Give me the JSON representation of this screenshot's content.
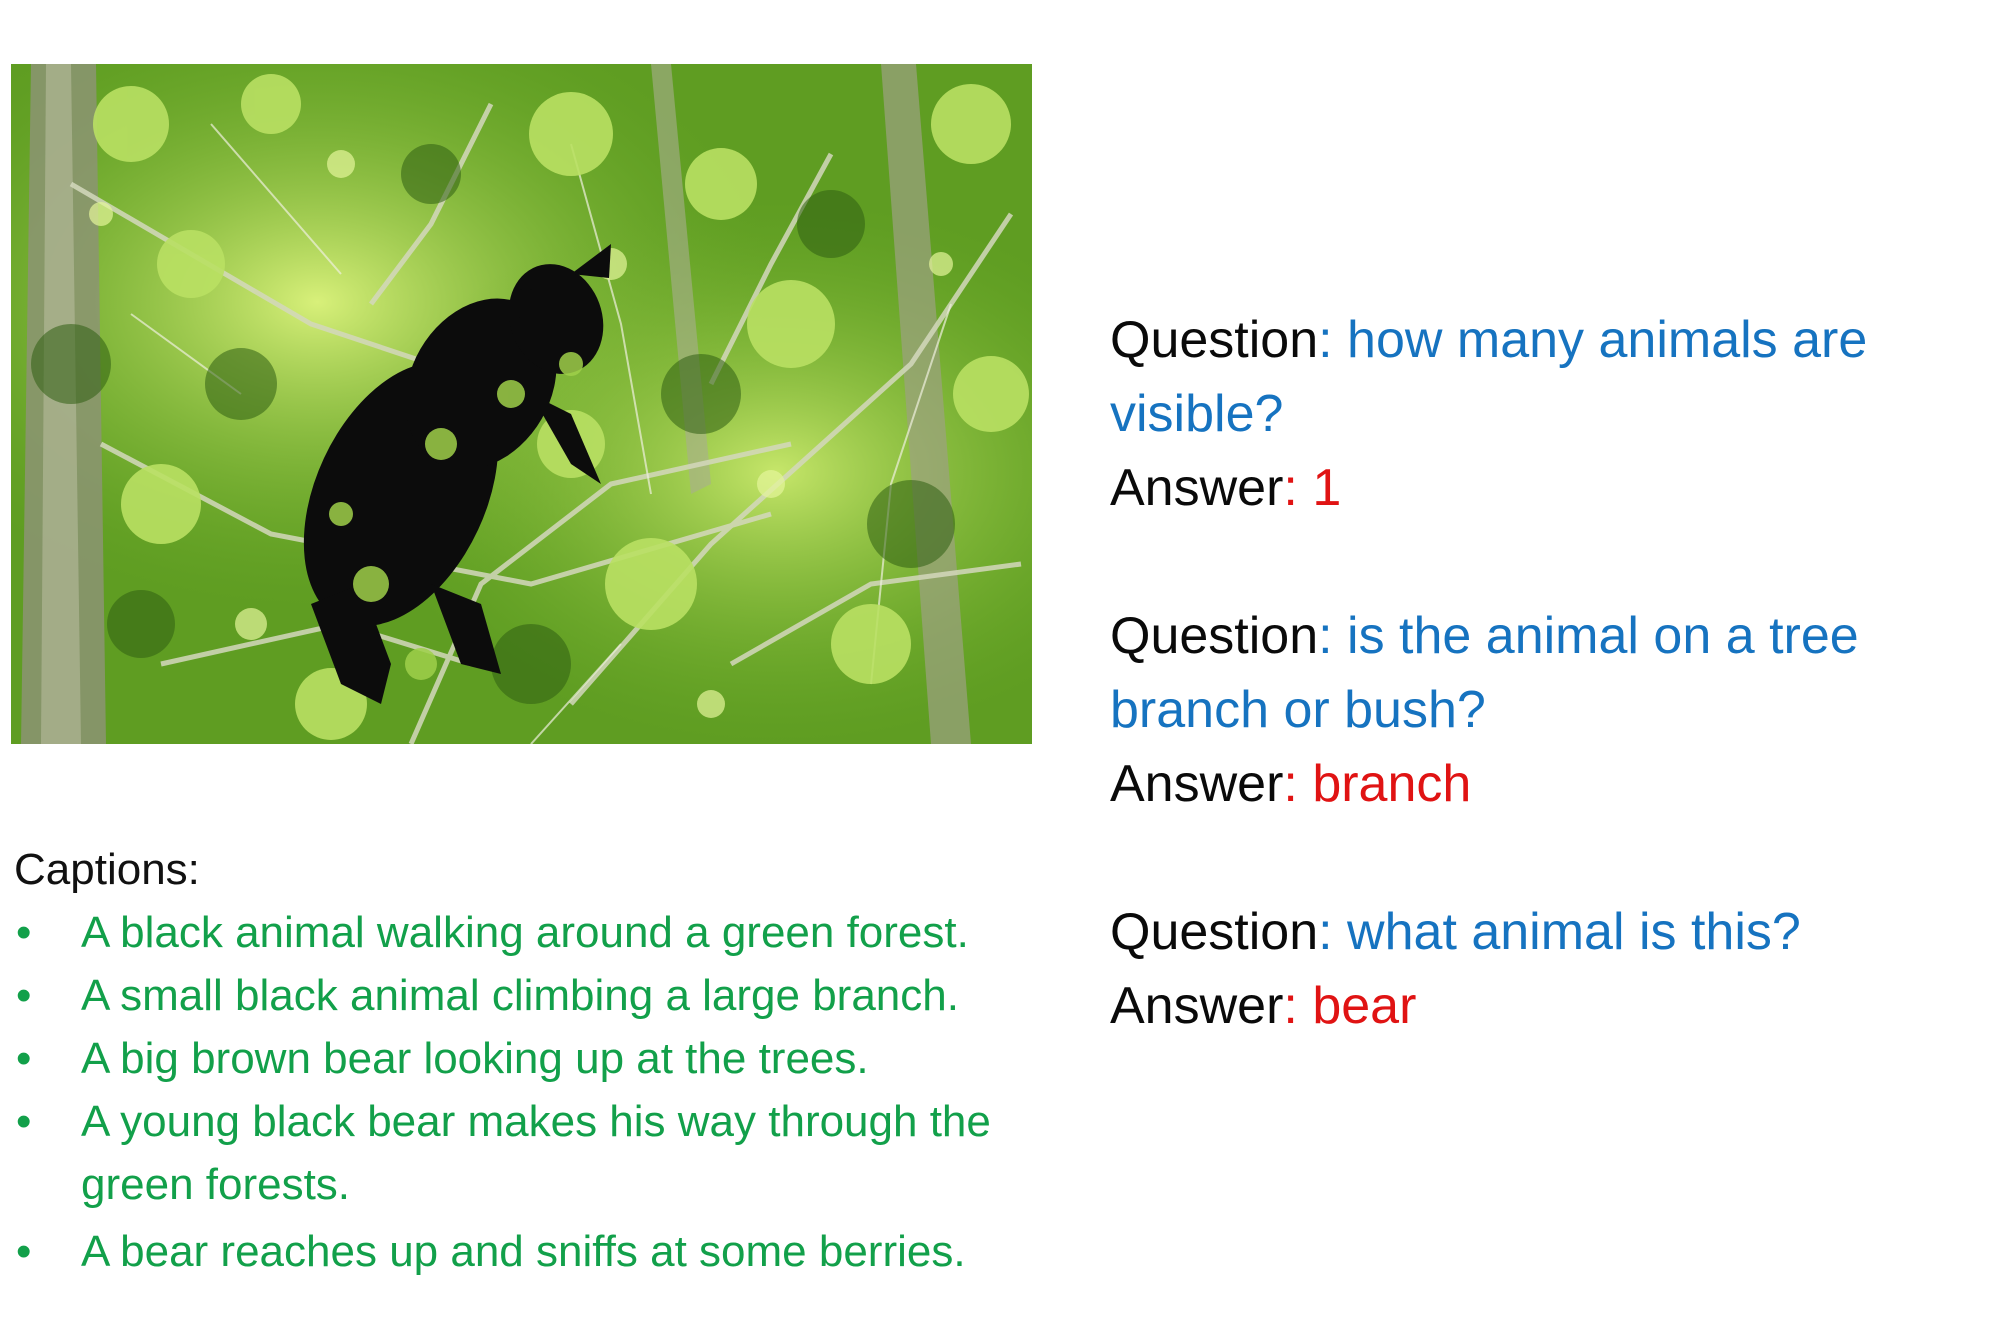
{
  "photo": {
    "subject": "bear-in-tree-photo",
    "colors": {
      "foliage": "#6fae2a",
      "light_leaves": "#b9e063",
      "dark_leaves": "#2f5e12",
      "bear": "#0c0c0c",
      "branches": "#cfd3b8"
    }
  },
  "captions": {
    "heading": "Captions:",
    "bullet": "•",
    "items": [
      "A black animal walking around a green forest.",
      "A small black animal climbing a large branch.",
      "A big brown bear looking up at the trees.",
      "A young black bear makes his way through the green forests.",
      "A bear reaches up and sniffs at some berries."
    ]
  },
  "qa": {
    "question_label": "Question",
    "answer_label": "Answer",
    "separator": ": ",
    "pairs": [
      {
        "question": "how many animals are visible?",
        "answer": "1"
      },
      {
        "question": "is the animal on a tree branch or bush?",
        "answer": "branch"
      },
      {
        "question": "what animal is this?",
        "answer": "bear"
      }
    ]
  },
  "colors": {
    "label": "#0a0a0a",
    "question": "#1673c0",
    "answer": "#e01313",
    "caption": "#12a04a"
  }
}
